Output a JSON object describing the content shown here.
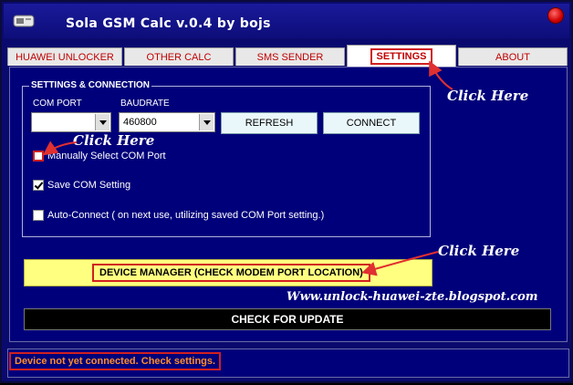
{
  "window": {
    "title": "Sola GSM Calc  v.0.4  by bojs"
  },
  "tabs": [
    {
      "label": "HUAWEI UNLOCKER"
    },
    {
      "label": "OTHER CALC"
    },
    {
      "label": "SMS SENDER"
    },
    {
      "label": "SETTINGS",
      "active": true
    },
    {
      "label": "ABOUT"
    }
  ],
  "settings": {
    "group_title": "SETTINGS & CONNECTION",
    "com_port_label": "COM PORT",
    "com_port_value": "",
    "baudrate_label": "BAUDRATE",
    "baudrate_value": "460800",
    "refresh_label": "REFRESH",
    "connect_label": "CONNECT",
    "manual_select_label": "Manually Select COM Port",
    "manual_select_checked": false,
    "save_com_label": "Save COM Setting",
    "save_com_checked": true,
    "auto_connect_label": "Auto-Connect ( on next use, utilizing saved COM Port setting.)",
    "auto_connect_checked": false
  },
  "device_manager_label": "DEVICE MANAGER (CHECK MODEM PORT LOCATION)",
  "watermark": "Www.unlock-huawei-zte.blogspot.com",
  "check_update_label": "CHECK FOR UPDATE",
  "status": {
    "text": "Device not yet connected. Check settings."
  },
  "annotations": {
    "tab_hint": "Click Here",
    "checkbox_hint": "Click Here",
    "devmgr_hint": "Click Here"
  },
  "colors": {
    "panel_bg": "#00007a",
    "tab_text": "#c00000",
    "highlight_red": "#d02020",
    "status_text": "#ff8c2a",
    "devmgr_bg": "#ffff80"
  },
  "icons": {
    "app": "app-icon",
    "close": "close-icon",
    "dropdown": "chevron-down-icon"
  }
}
